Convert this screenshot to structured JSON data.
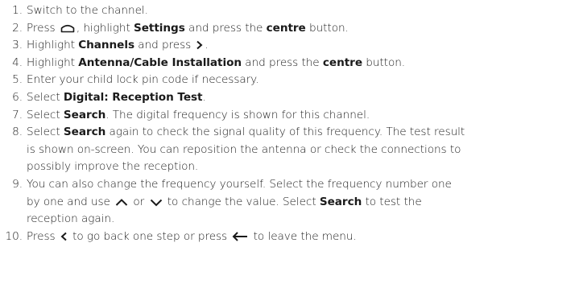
{
  "steps": [
    {
      "number": "1.",
      "segments": [
        {
          "t": "Switch to the channel."
        }
      ]
    },
    {
      "number": "2.",
      "segments": [
        {
          "t": "Press "
        },
        {
          "icon": "home-icon"
        },
        {
          "t": ", highlight "
        },
        {
          "t": "Settings",
          "b": true
        },
        {
          "t": " and press the "
        },
        {
          "t": "centre",
          "b": true
        },
        {
          "t": " button."
        }
      ]
    },
    {
      "number": "3.",
      "segments": [
        {
          "t": "Highlight "
        },
        {
          "t": "Channels",
          "b": true
        },
        {
          "t": " and press "
        },
        {
          "icon": "chevron-right-icon"
        },
        {
          "t": "."
        }
      ]
    },
    {
      "number": "4.",
      "segments": [
        {
          "t": "Highlight "
        },
        {
          "t": "Antenna/Cable Installation",
          "b": true
        },
        {
          "t": " and press the "
        },
        {
          "t": "centre",
          "b": true
        },
        {
          "t": " button."
        }
      ]
    },
    {
      "number": "5.",
      "segments": [
        {
          "t": "Enter your child lock pin code if necessary."
        }
      ]
    },
    {
      "number": "6.",
      "segments": [
        {
          "t": "Select "
        },
        {
          "t": "Digital: Reception Test",
          "b": true
        },
        {
          "t": "."
        }
      ]
    },
    {
      "number": "7.",
      "segments": [
        {
          "t": "Select "
        },
        {
          "t": "Search",
          "b": true
        },
        {
          "t": ". The digital frequency is shown for this channel."
        }
      ]
    },
    {
      "number": "8.",
      "segments": [
        {
          "t": "Select "
        },
        {
          "t": "Search",
          "b": true
        },
        {
          "t": " again to check the signal quality of this frequency. The test result"
        },
        {
          "br": true
        },
        {
          "t": "is shown on-screen. You can reposition the antenna or check the connections to"
        },
        {
          "br": true
        },
        {
          "t": "possibly improve the reception."
        }
      ]
    },
    {
      "number": "9.",
      "segments": [
        {
          "t": "You can also change the frequency yourself. Select the frequency number one"
        },
        {
          "br": true
        },
        {
          "t": "by one and use "
        },
        {
          "icon": "chevron-up-icon"
        },
        {
          "t": " or "
        },
        {
          "icon": "chevron-down-icon"
        },
        {
          "t": " to change the value. Select "
        },
        {
          "t": "Search",
          "b": true
        },
        {
          "t": " to test the"
        },
        {
          "br": true
        },
        {
          "t": "reception again."
        }
      ]
    },
    {
      "number": "10.",
      "segments": [
        {
          "t": "Press "
        },
        {
          "icon": "chevron-left-icon"
        },
        {
          "t": " to go back one step or press "
        },
        {
          "icon": "arrow-left-icon"
        },
        {
          "t": " to leave the menu."
        }
      ]
    }
  ]
}
